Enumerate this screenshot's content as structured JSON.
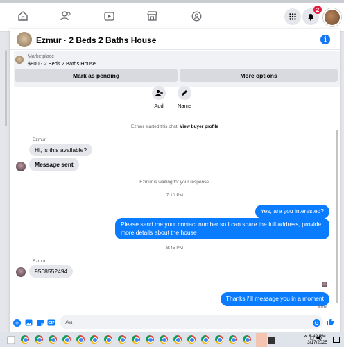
{
  "topnav": {
    "icons": [
      "home-icon",
      "friends-icon",
      "video-icon",
      "marketplace-icon",
      "groups-icon"
    ],
    "notification_count": "2"
  },
  "chat": {
    "title": "Ezmur · 2 Beds 2 Baths House",
    "listing": {
      "label": "Marketplace",
      "description": "$800 - 2 Beds 2 Baths House"
    },
    "buttons": {
      "mark_pending": "Mark as pending",
      "more_options": "More options"
    },
    "quick_actions": {
      "add": "Add",
      "name": "Name"
    },
    "system": {
      "started": "Ezmur started this chat.",
      "view_profile": "View buyer profile",
      "waiting": "Ezmur is waiting for your response."
    },
    "timestamps": {
      "t1": "7:10 PM",
      "t2": "8:45 PM"
    },
    "messages": {
      "sender1": "Ezmur",
      "in1": "Hi, is this available?",
      "in2": "Message sent",
      "out1": "Yes, are you interested?",
      "out2": "Please send me your contact number so I can share the full address, provide more details about the house",
      "sender2": "Ezmur",
      "in3": "9568552494",
      "out3": "Thanks i''ll message you in a moment",
      "sent_status": "Sent"
    },
    "composer": {
      "placeholder": "Aa"
    }
  },
  "taskbar": {
    "time": "8:49 PM",
    "date": "3/17/2025"
  },
  "colors": {
    "accent": "#0a7cff",
    "badge": "#e41e3f"
  }
}
